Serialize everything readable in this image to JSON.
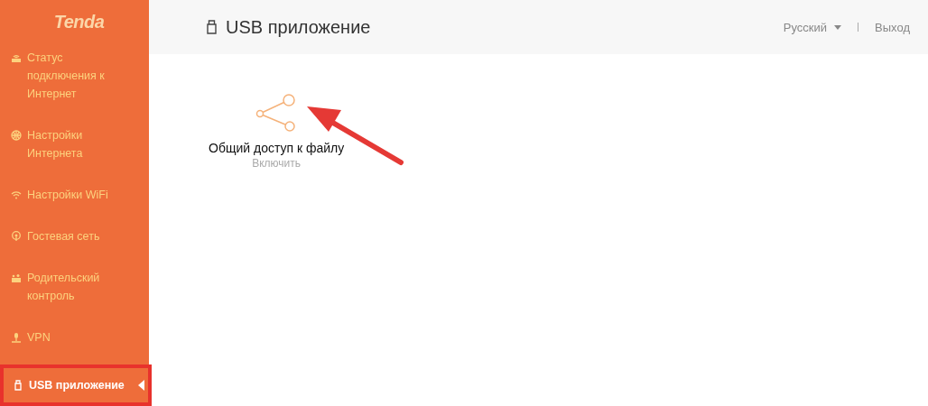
{
  "sidebar": {
    "logo": "Tenda",
    "items": [
      {
        "label": "Статус подключения к Интернет",
        "kind": "router",
        "selected": false
      },
      {
        "label": "Настройки Интернета",
        "kind": "globe",
        "selected": false
      },
      {
        "label": "Настройки WiFi",
        "kind": "wifi",
        "selected": false
      },
      {
        "label": "Гостевая сеть",
        "kind": "guest",
        "selected": false
      },
      {
        "label": "Родительский контроль",
        "kind": "parental",
        "selected": false
      },
      {
        "label": "VPN",
        "kind": "vpn",
        "selected": false
      },
      {
        "label": "USB приложение",
        "kind": "usb",
        "selected": true
      }
    ]
  },
  "header": {
    "title": "USB приложение",
    "language": "Русский",
    "logout": "Выход"
  },
  "apps": [
    {
      "name": "Общий доступ к файлу",
      "action": "Включить"
    }
  ]
}
